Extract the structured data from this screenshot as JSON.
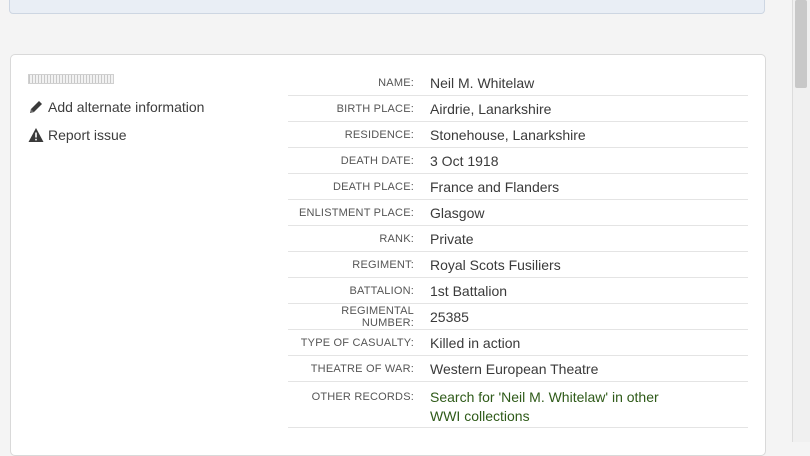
{
  "actions": {
    "add_alternate": "Add alternate information",
    "report_issue": "Report issue"
  },
  "record": [
    {
      "label": "NAME:",
      "value": "Neil M. Whitelaw"
    },
    {
      "label": "BIRTH PLACE:",
      "value": "Airdrie, Lanarkshire"
    },
    {
      "label": "RESIDENCE:",
      "value": "Stonehouse, Lanarkshire"
    },
    {
      "label": "DEATH DATE:",
      "value": "3 Oct 1918"
    },
    {
      "label": "DEATH PLACE:",
      "value": "France and Flanders"
    },
    {
      "label": "ENLISTMENT PLACE:",
      "value": "Glasgow"
    },
    {
      "label": "RANK:",
      "value": "Private"
    },
    {
      "label": "REGIMENT:",
      "value": "Royal Scots Fusiliers"
    },
    {
      "label": "BATTALION:",
      "value": "1st Battalion"
    },
    {
      "label": "REGIMENTAL NUMBER:",
      "value": "25385"
    },
    {
      "label": "TYPE OF CASUALTY:",
      "value": "Killed in action"
    },
    {
      "label": "THEATRE OF WAR:",
      "value": "Western European Theatre"
    },
    {
      "label": "OTHER RECORDS:",
      "value": "Search for 'Neil M. Whitelaw' in other WWI collections"
    }
  ],
  "colors": {
    "icon": "#3a3a3a",
    "link": "#2e5a18"
  },
  "icons": {
    "edit": "pencil-icon",
    "report": "warning-icon"
  }
}
